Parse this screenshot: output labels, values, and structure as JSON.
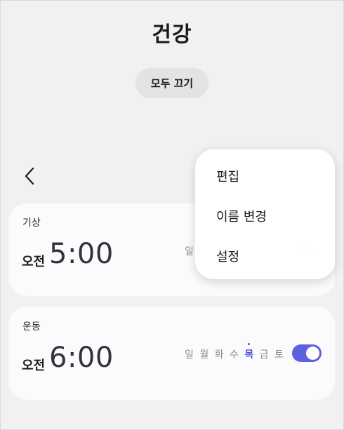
{
  "header": {
    "title": "건강",
    "all_off_label": "모두 끄기"
  },
  "alarms": [
    {
      "label": "기상",
      "ampm": "오전",
      "time": "5:00",
      "days_visible": [
        "일"
      ]
    },
    {
      "label": "운동",
      "ampm": "오전",
      "time": "6:00",
      "days": [
        "일",
        "월",
        "화",
        "수",
        "목",
        "금",
        "토"
      ],
      "active_day": "목",
      "enabled": true
    }
  ],
  "context_menu": {
    "items": [
      "편집",
      "이름 변경",
      "설정"
    ]
  },
  "icons": {
    "back": "chevron-left-icon"
  },
  "colors": {
    "accent": "#5d61df",
    "active_day": "#4f56d6",
    "background": "#f1f1f3",
    "card": "#fbfbfd"
  }
}
